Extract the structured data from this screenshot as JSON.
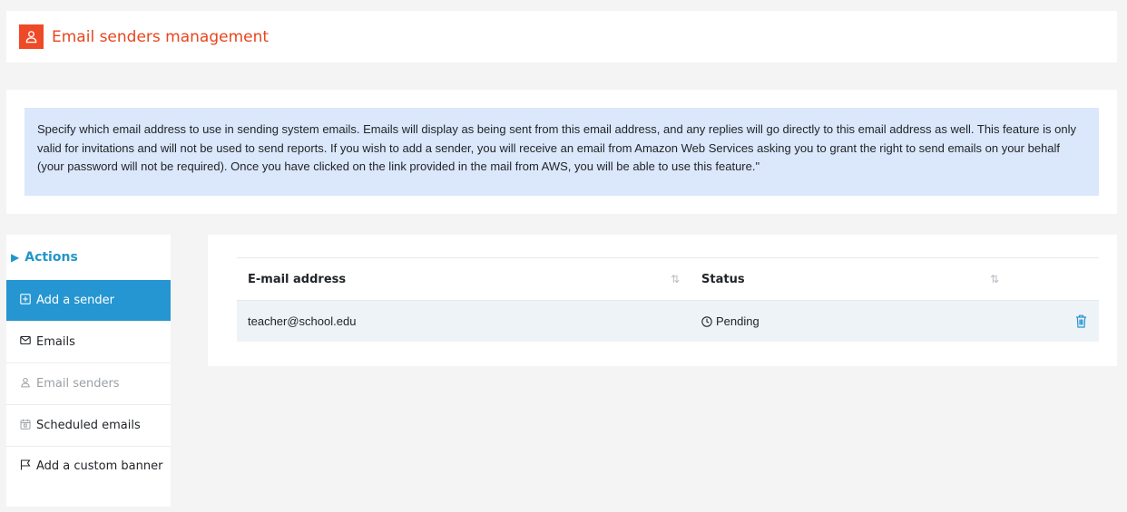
{
  "header": {
    "title": "Email senders management"
  },
  "info": {
    "text": "Specify which email address to use in sending system emails. Emails will display as being sent from this email address, and any replies will go directly to this email address as well. This feature is only valid for invitations and will not be used to send reports. If you wish to add a sender, you will receive an email from Amazon Web Services asking you to grant the right to send emails on your behalf (your password will not be required). Once you have clicked on the link provided in the mail from AWS, you will be able to use this feature.\""
  },
  "actions": {
    "title": "Actions",
    "items": [
      {
        "label": "Add a sender",
        "icon": "plus-square-icon",
        "state": "active"
      },
      {
        "label": "Emails",
        "icon": "mail-icon",
        "state": "normal"
      },
      {
        "label": "Email senders",
        "icon": "user-icon",
        "state": "disabled"
      },
      {
        "label": "Scheduled emails",
        "icon": "calendar-icon",
        "state": "normal"
      },
      {
        "label": "Add a custom banner",
        "icon": "flag-icon",
        "state": "normal"
      }
    ]
  },
  "table": {
    "columns": [
      "E-mail address",
      "Status"
    ],
    "rows": [
      {
        "email": "teacher@school.edu",
        "status": "Pending"
      }
    ]
  },
  "colors": {
    "accent": "#ef4a27",
    "primary": "#2596d1",
    "info_bg": "#dbe7fb"
  }
}
